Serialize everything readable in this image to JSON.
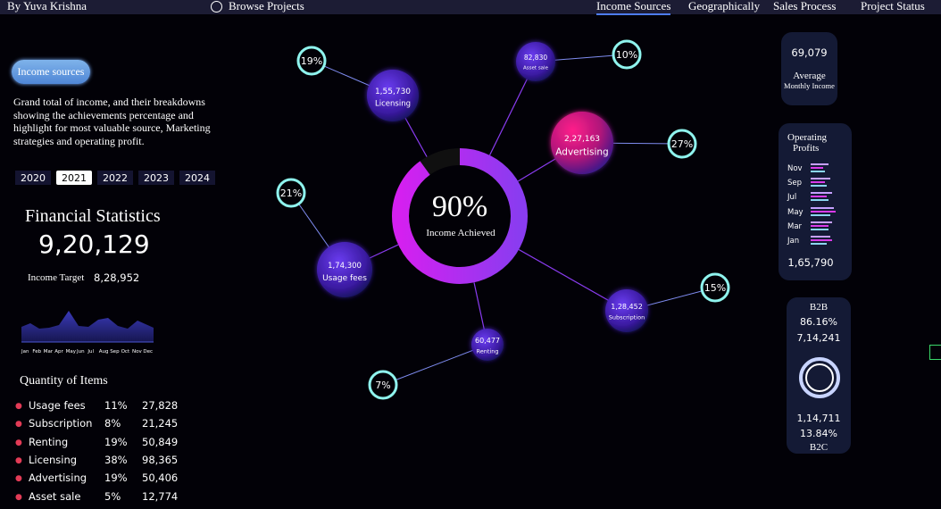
{
  "header": {
    "author": "By Yuva Krishna",
    "browse": "Browse Projects",
    "tabs": [
      "Income Sources",
      "Geographically",
      "Sales Process",
      "Project Status"
    ]
  },
  "left": {
    "pill": "Income sources",
    "description": "Grand total of income, and their breakdowns showing the achievements percentage and highlight for most valuable source, Marketing strategies and operating profit.",
    "years": [
      "2020",
      "2021",
      "2022",
      "2023",
      "2024"
    ],
    "selected_year": "2021",
    "fin_title": "Financial Statistics",
    "fin_total": "9,20,129",
    "target_label": "Income Target",
    "target_value": "8,28,952",
    "months": [
      "Jan",
      "Feb",
      "Mar",
      "Apr",
      "May",
      "Jun",
      "Jul",
      "Aug",
      "Sep",
      "Oct",
      "Nov",
      "Dec"
    ],
    "qty_title": "Quantity of Items",
    "items": [
      {
        "name": "Usage fees",
        "pct": "11%",
        "value": "27,828"
      },
      {
        "name": "Subscription",
        "pct": "8%",
        "value": "21,245"
      },
      {
        "name": "Renting",
        "pct": "19%",
        "value": "50,849"
      },
      {
        "name": "Licensing",
        "pct": "38%",
        "value": "98,365"
      },
      {
        "name": "Advertising",
        "pct": "19%",
        "value": "50,406"
      },
      {
        "name": "Asset sale",
        "pct": "5%",
        "value": "12,774"
      }
    ]
  },
  "center": {
    "achieved_pct": "90%",
    "achieved_label": "Income Achieved",
    "achieved_fraction": 0.9,
    "nodes": [
      {
        "value": "1,55,730",
        "label": "Licensing",
        "pct": "19%"
      },
      {
        "value": "82,830",
        "label": "Asset sale",
        "pct": "10%"
      },
      {
        "value": "2,27,163",
        "label": "Advertising",
        "pct": "27%"
      },
      {
        "value": "1,74,300",
        "label": "Usage fees",
        "pct": "21%"
      },
      {
        "value": "1,28,452",
        "label": "Subscription",
        "pct": "15%"
      },
      {
        "value": "60,477",
        "label": "Renting",
        "pct": "7%"
      }
    ]
  },
  "right": {
    "avg_value": "69,079",
    "avg_label1": "Average",
    "avg_label2": "Monthly Income",
    "op_label1": "Operating",
    "op_label2": "Profits",
    "op_months": [
      "Nov",
      "Sep",
      "Jul",
      "May",
      "Mar",
      "Jan"
    ],
    "op_total": "1,65,790",
    "b2b_label": "B2B",
    "b2b_pct": "86.16%",
    "b2b_value": "7,14,241",
    "b2c_value": "1,14,711",
    "b2c_pct": "13.84%",
    "b2c_label": "B2C",
    "b2b_fraction": 0.8616
  },
  "colors": {
    "accent": "#d62bf0",
    "ring_bg": "#101010",
    "badge": "#8ff4ee",
    "bar": "#4b58d6"
  }
}
